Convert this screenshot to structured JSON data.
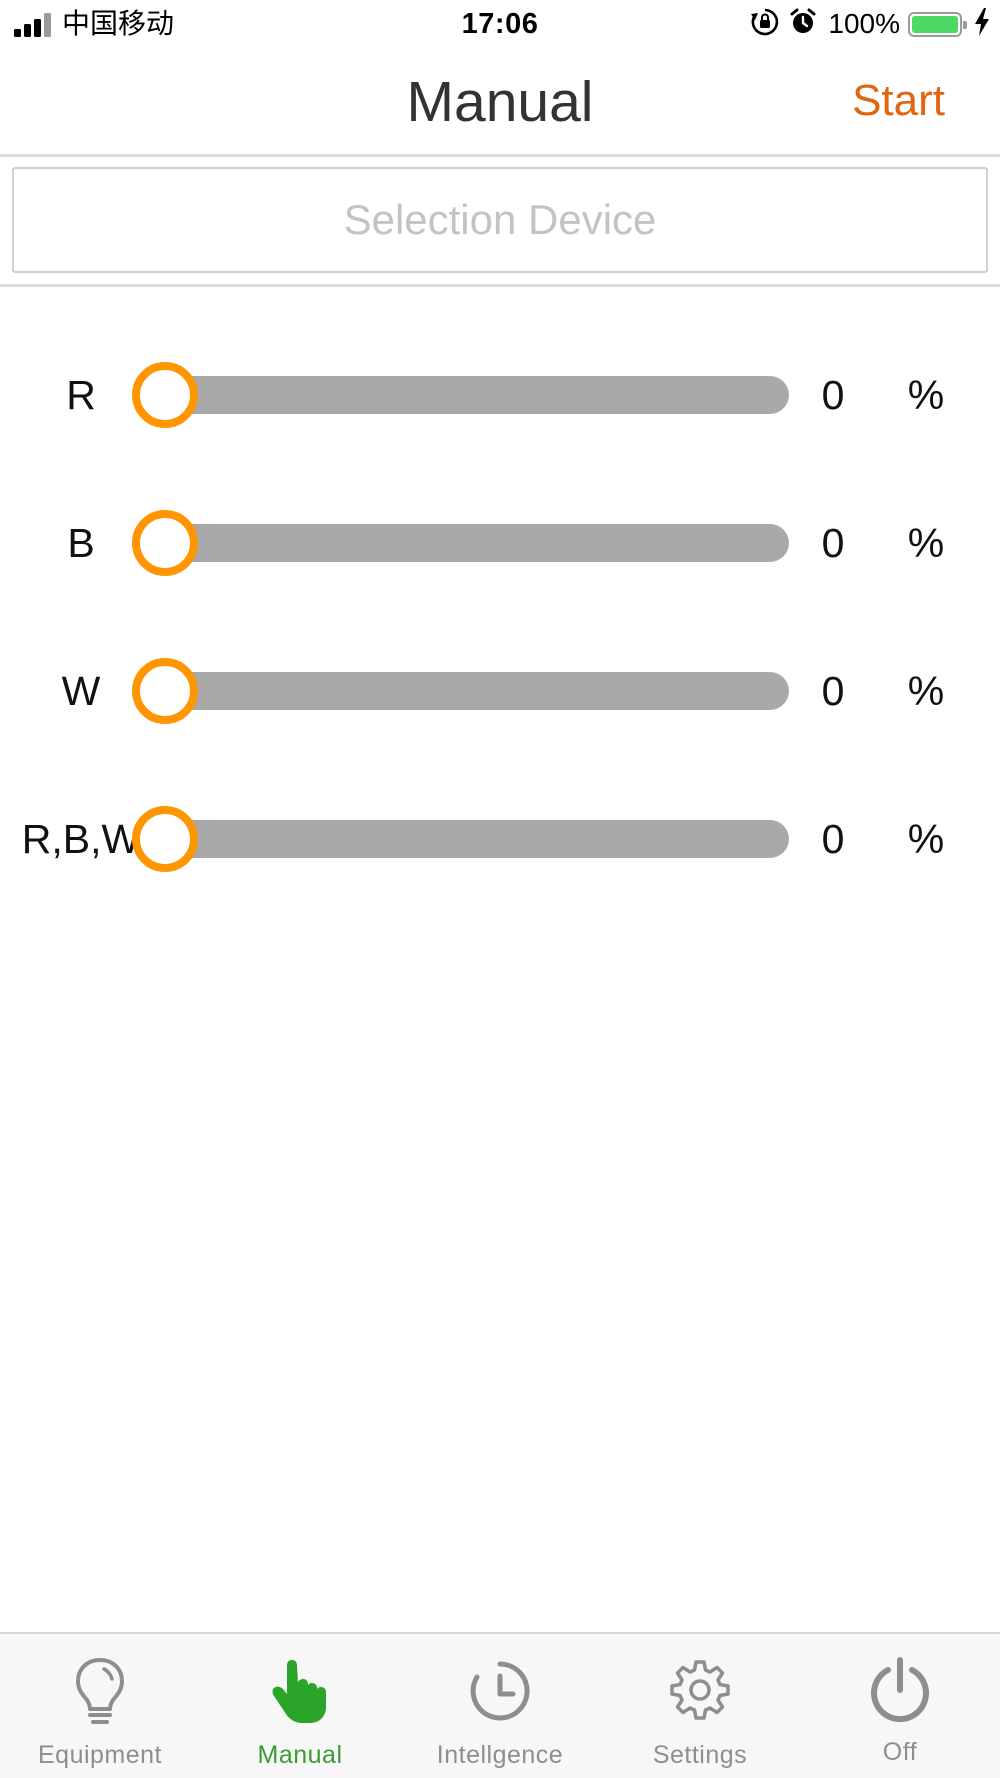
{
  "status_bar": {
    "carrier": "中国移动",
    "time": "17:06",
    "battery_percent": "100%",
    "battery_level": 1.0
  },
  "nav": {
    "title": "Manual",
    "start_label": "Start"
  },
  "device_select": {
    "placeholder": "Selection Device"
  },
  "sliders": [
    {
      "label": "R",
      "value": "0",
      "unit": "%",
      "level": 0
    },
    {
      "label": "B",
      "value": "0",
      "unit": "%",
      "level": 0
    },
    {
      "label": "W",
      "value": "0",
      "unit": "%",
      "level": 0
    },
    {
      "label": "R,B,W",
      "value": "0",
      "unit": "%",
      "level": 0
    }
  ],
  "tabs": [
    {
      "label": "Equipment",
      "icon": "lightbulb-icon",
      "active": false
    },
    {
      "label": "Manual",
      "icon": "hand-pointer-icon",
      "active": true
    },
    {
      "label": "Intellgence",
      "icon": "clock-icon",
      "active": false
    },
    {
      "label": "Settings",
      "icon": "gear-icon",
      "active": false
    },
    {
      "label": "Off",
      "icon": "power-icon",
      "active": false
    }
  ],
  "colors": {
    "accent": "#e0660f",
    "thumb": "#ff9500",
    "track": "#a9a9a9",
    "tab_active": "#3a9c30",
    "tab_inactive": "#8e8e8e",
    "battery": "#4cd964"
  }
}
